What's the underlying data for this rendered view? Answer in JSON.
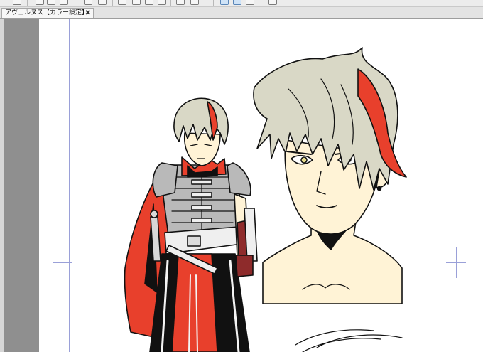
{
  "document_tab": {
    "title": "アヴェルヌス【カラー設定】",
    "close_glyph": "✖"
  },
  "toolbar": {
    "buttons": [
      {
        "icon": "gear-icon"
      },
      {
        "icon": "new-file-icon"
      },
      {
        "icon": "open-file-icon"
      },
      {
        "icon": "save-icon"
      },
      {
        "icon": "undo-icon"
      },
      {
        "icon": "redo-icon"
      },
      {
        "icon": "selection-icon"
      },
      {
        "icon": "clear-icon"
      },
      {
        "icon": "transform-icon"
      },
      {
        "icon": "layer-icon"
      },
      {
        "icon": "fill-icon"
      },
      {
        "icon": "ruler-icon"
      },
      {
        "icon": "snap-icon"
      },
      {
        "icon": "settings-icon"
      }
    ]
  },
  "colors": {
    "accent_red": "#e8402c",
    "hair": "#d9d8c6",
    "skin": "#fff3d6",
    "armor": "#b9b9b9",
    "guide_lines": "#9aa0d8"
  }
}
